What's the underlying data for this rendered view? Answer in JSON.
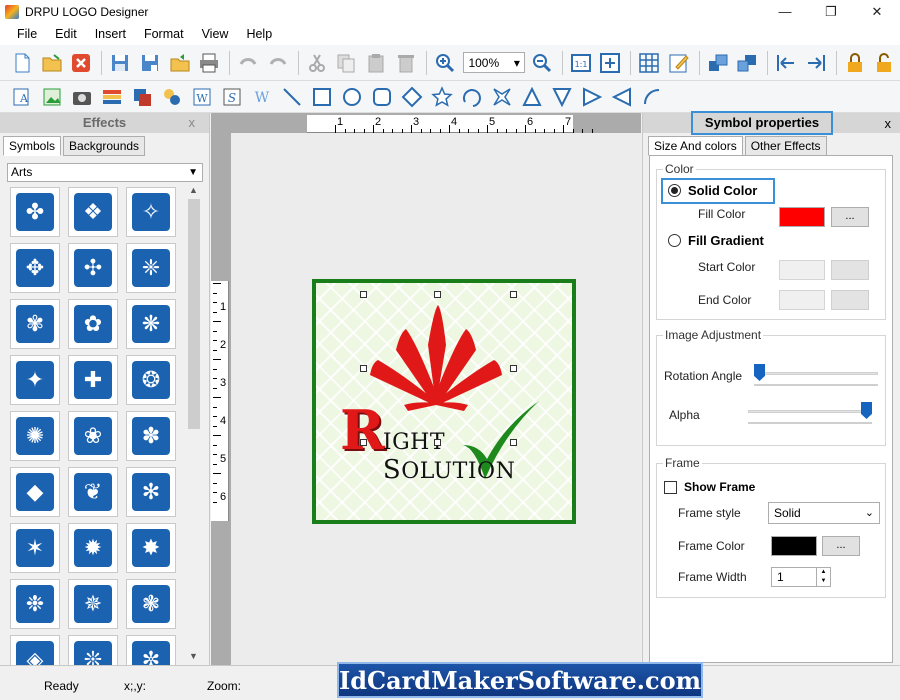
{
  "window": {
    "title": "DRPU LOGO Designer",
    "minimize": "—",
    "restore": "❐",
    "close": "✕"
  },
  "menu": [
    "File",
    "Edit",
    "Insert",
    "Format",
    "View",
    "Help"
  ],
  "toolbar": {
    "zoom": "100%"
  },
  "effects_panel": {
    "title": "Effects",
    "close": "x",
    "tabs": [
      "Symbols",
      "Backgrounds"
    ],
    "category": "Arts",
    "symbols": [
      "✤",
      "❖",
      "✧",
      "✥",
      "✣",
      "❈",
      "✾",
      "✿",
      "❋",
      "✦",
      "✚",
      "❂",
      "✺",
      "❀",
      "✽",
      "◆",
      "❦",
      "✻",
      "✶",
      "✹",
      "✸",
      "❉",
      "✵",
      "❃",
      "◈",
      "❊",
      "✼"
    ]
  },
  "canvas": {
    "ruler_top": [
      "1",
      "2",
      "3",
      "4",
      "5",
      "6",
      "7"
    ],
    "ruler_left": [
      "1",
      "2",
      "3",
      "4",
      "5",
      "6"
    ],
    "logo": {
      "big_letter": "R",
      "text_part1": "IGHT ",
      "text_cap": "S",
      "text_part2": "OLUTION",
      "leaf_color": "#e01818",
      "frame_color": "#197d1a",
      "check_color": "#1e8a1e"
    }
  },
  "props_panel": {
    "title": "Symbol properties",
    "close": "x",
    "tabs": [
      "Size And colors",
      "Other Effects"
    ],
    "color_group": "Color",
    "solid_color": "Solid Color",
    "fill_color_label": "Fill Color",
    "fill_color": "#ff0000",
    "fill_gradient": "Fill Gradient",
    "start_color_label": "Start Color",
    "end_color_label": "End Color",
    "dots": "...",
    "image_adjustment_group": "Image Adjustment",
    "rotation_angle_label": "Rotation Angle",
    "alpha_label": "Alpha",
    "rotation_value": 0,
    "alpha_value": 1,
    "frame_group": "Frame",
    "show_frame": "Show Frame",
    "frame_style_label": "Frame style",
    "frame_style": "Solid",
    "frame_color_label": "Frame Color",
    "frame_color": "#000000",
    "frame_width_label": "Frame Width",
    "frame_width": "1"
  },
  "status": {
    "ready": "Ready",
    "xy": "x;,y:",
    "zoom": "Zoom:"
  },
  "watermark": "IdCardMakerSoftware.com"
}
